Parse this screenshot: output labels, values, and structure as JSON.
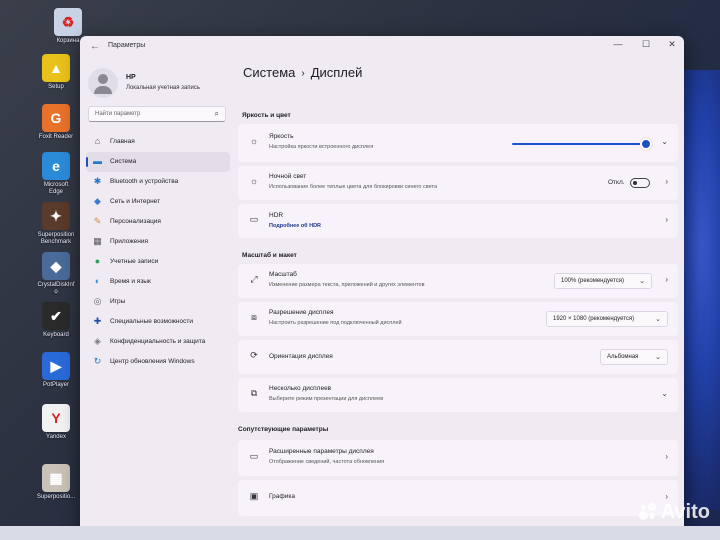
{
  "desktop": {
    "icons": [
      {
        "label": "Корзина",
        "icon": "recycle-bin-icon",
        "color": "#c8d3e6",
        "glyph": "♻"
      },
      {
        "label": "Setup",
        "icon": "setup-icon",
        "color": "#e8c21a",
        "glyph": "▲"
      },
      {
        "label": "Foxit Reader",
        "icon": "foxit-reader-icon",
        "color": "#e8722a",
        "glyph": "G"
      },
      {
        "label": "Microsoft Edge",
        "icon": "edge-icon",
        "color": "#2b8bd8",
        "glyph": "e"
      },
      {
        "label": "Superposition Benchmark",
        "icon": "superposition-icon",
        "color": "#5a3a2a",
        "glyph": "✦"
      },
      {
        "label": "CrystalDiskInfo",
        "icon": "crystaldiskinfo-icon",
        "color": "#4a6a9a",
        "glyph": "◆"
      },
      {
        "label": "Keyboard",
        "icon": "keyboard-test-icon",
        "color": "#2a2a2a",
        "glyph": "✔"
      },
      {
        "label": "PotPlayer",
        "icon": "potplayer-icon",
        "color": "#2a6ad8",
        "glyph": "▶"
      },
      {
        "label": "Yandex",
        "icon": "yandex-icon",
        "color": "#f2f2f2",
        "glyph": "Y"
      },
      {
        "label": "Superpositio...",
        "icon": "superposition-file-icon",
        "color": "#c8c2b8",
        "glyph": "▦"
      }
    ],
    "watermark": "Avito"
  },
  "window": {
    "title": "Параметры",
    "controls": {
      "minimize": "—",
      "maximize": "☐",
      "close": "✕"
    }
  },
  "sidebar": {
    "user_name": "HP",
    "user_sub": "Локальная учетная запись",
    "search_placeholder": "Найти параметр",
    "items": [
      {
        "label": "Главная",
        "icon": "home-icon",
        "glyph": "⌂",
        "color": "#555"
      },
      {
        "label": "Система",
        "icon": "system-icon",
        "glyph": "▬",
        "color": "#1f78d1"
      },
      {
        "label": "Bluetooth и устройства",
        "icon": "bluetooth-icon",
        "glyph": "✱",
        "color": "#1f78d1"
      },
      {
        "label": "Сеть и Интернет",
        "icon": "network-icon",
        "glyph": "◆",
        "color": "#3a7ad0"
      },
      {
        "label": "Персонализация",
        "icon": "personalization-icon",
        "glyph": "✎",
        "color": "#d08a3a"
      },
      {
        "label": "Приложения",
        "icon": "apps-icon",
        "glyph": "▦",
        "color": "#555"
      },
      {
        "label": "Учетные записи",
        "icon": "accounts-icon",
        "glyph": "●",
        "color": "#2aa05a"
      },
      {
        "label": "Время и язык",
        "icon": "time-language-icon",
        "glyph": "◐",
        "color": "#2a8ad0"
      },
      {
        "label": "Игры",
        "icon": "gaming-icon",
        "glyph": "◎",
        "color": "#666"
      },
      {
        "label": "Специальные возможности",
        "icon": "accessibility-icon",
        "glyph": "✚",
        "color": "#1f4fa8"
      },
      {
        "label": "Конфиденциальность и защита",
        "icon": "privacy-icon",
        "glyph": "◈",
        "color": "#777"
      },
      {
        "label": "Центр обновления Windows",
        "icon": "windows-update-icon",
        "glyph": "↻",
        "color": "#1f78d1"
      }
    ],
    "active_index": 1
  },
  "main": {
    "breadcrumb_parent": "Система",
    "breadcrumb_sep": "›",
    "breadcrumb_current": "Дисплей",
    "section_brightness": "Яркость и цвет",
    "brightness": {
      "title": "Яркость",
      "sub": "Настройка яркости встроенного дисплея",
      "icon": "brightness-icon",
      "glyph": "☼",
      "level": 1.0
    },
    "night_light": {
      "title": "Ночной свет",
      "sub": "Использование более теплые цвета для блокировки синего света",
      "icon": "night-light-icon",
      "glyph": "☼",
      "state": "Откл."
    },
    "hdr": {
      "title": "HDR",
      "sub": "Подробнее об HDR"
    },
    "section_scale": "Масштаб и макет",
    "scale": {
      "title": "Масштаб",
      "sub": "Изменение размера текста, приложений и других элементов",
      "icon": "scale-icon",
      "glyph": "⤢",
      "value": "100% (рекомендуется)"
    },
    "resolution": {
      "title": "Разрешение дисплея",
      "sub": "Настроить разрешение под подключенный дисплей",
      "icon": "resolution-icon",
      "glyph": "⧈",
      "value": "1920 × 1080 (рекомендуется)"
    },
    "orientation": {
      "title": "Ориентация дисплея",
      "icon": "orientation-icon",
      "glyph": "⟳",
      "value": "Альбомная"
    },
    "multi": {
      "title": "Несколько дисплеев",
      "sub": "Выберите режим презентации для дисплеев",
      "icon": "multiple-displays-icon",
      "glyph": "⧉"
    },
    "section_related": "Сопутствующие параметры",
    "advanced": {
      "title": "Расширенные параметры дисплея",
      "sub": "Отображение сведений, частота обновления",
      "icon": "monitor-icon",
      "glyph": "▭"
    },
    "graphics": {
      "title": "Графика",
      "icon": "graphics-icon",
      "glyph": "▣"
    }
  },
  "colors": {
    "accent": "#1f50c8"
  }
}
